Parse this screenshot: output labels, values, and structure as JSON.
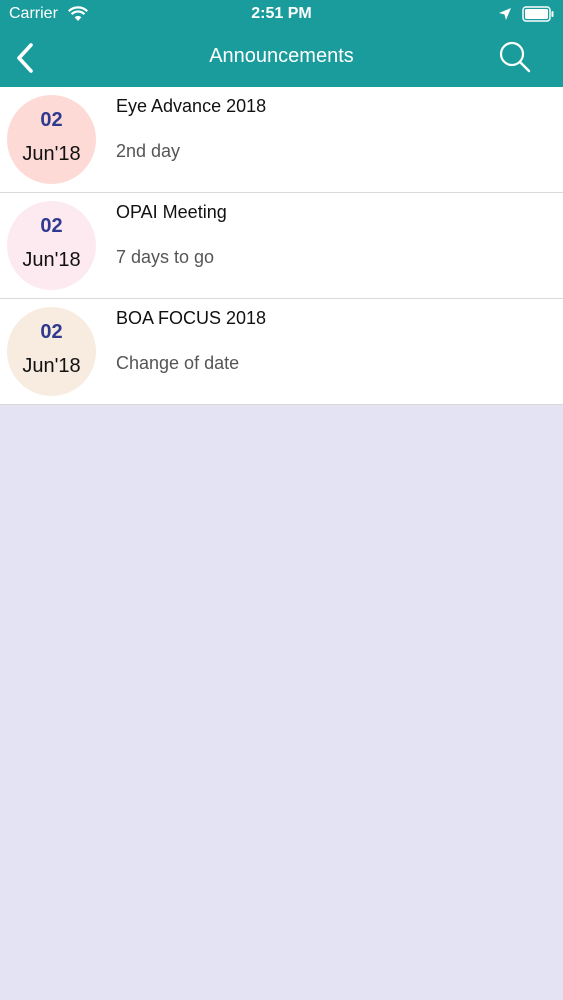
{
  "status_bar": {
    "carrier": "Carrier",
    "time": "2:51 PM",
    "icons": [
      "wifi-icon",
      "location-arrow-icon",
      "battery-icon"
    ]
  },
  "nav": {
    "title": "Announcements",
    "back_icon": "chevron-left-icon",
    "search_icon": "search-icon",
    "background_color": "#1b9c9c"
  },
  "announcements": [
    {
      "day": "02",
      "month": "Jun'18",
      "title": "Eye Advance 2018",
      "subtitle": "2nd day",
      "circle_color": "#fddad6"
    },
    {
      "day": "02",
      "month": "Jun'18",
      "title": "OPAI Meeting",
      "subtitle": "7 days to go",
      "circle_color": "#fdeaf1"
    },
    {
      "day": "02",
      "month": "Jun'18",
      "title": "BOA FOCUS 2018",
      "subtitle": "Change of date",
      "circle_color": "#f8ebdf"
    }
  ],
  "colors": {
    "background": "#e3e3f3",
    "day_text": "#2f3a8f"
  }
}
